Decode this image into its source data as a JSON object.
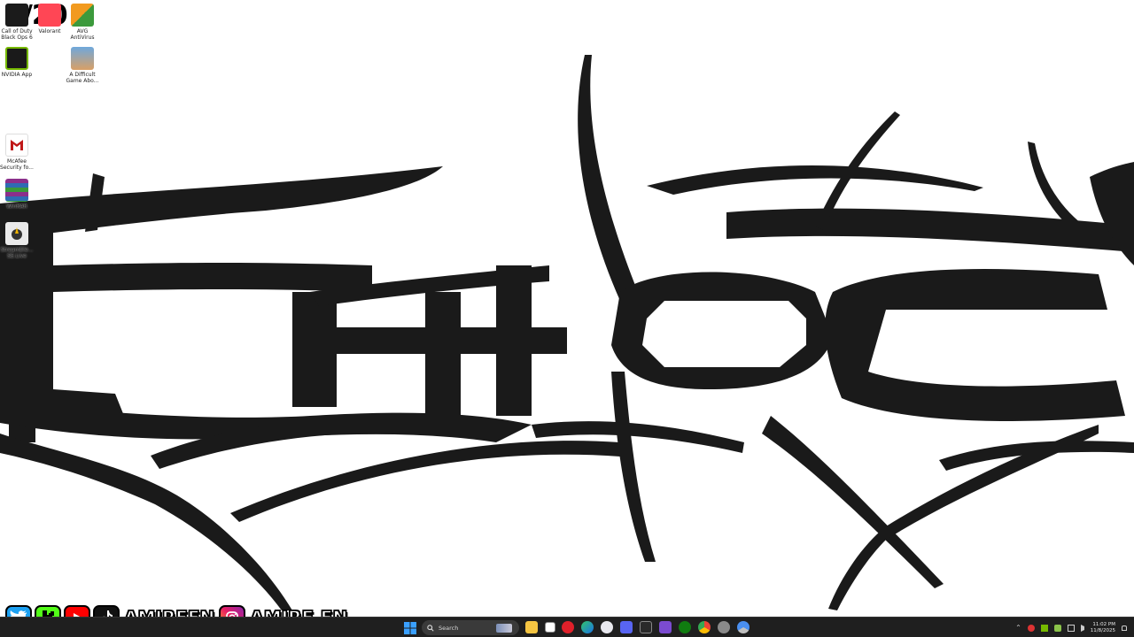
{
  "overlay": {
    "counter": "0/20"
  },
  "desktop": {
    "icons": [
      {
        "label": "Call of Duty\nBlack Ops 6",
        "icon": "cod-icon",
        "color": "#1b1b1b"
      },
      {
        "label": "Valorant",
        "icon": "valorant-icon",
        "color": "#ff4655"
      },
      {
        "label": "AVG\nAntiVirus",
        "icon": "avg-icon",
        "color": "#f29a1f"
      },
      {
        "label": "NVIDIA App",
        "icon": "nvidia-icon",
        "color": "#76b900"
      },
      {
        "label": "A Difficult\nGame Abo...",
        "icon": "game-icon",
        "color": "#6fa8dc"
      },
      {
        "label": "McAfee\nSecurity fo...",
        "icon": "mcafee-icon",
        "color": "#c01818"
      },
      {
        "label": "WinRAR",
        "icon": "winrar-icon",
        "color": "#8b2f8b"
      },
      {
        "label": "StreamEle...\nSE.Live",
        "icon": "streamelements-icon",
        "color": "#333333"
      }
    ]
  },
  "social": {
    "handles": [
      "AMIREFN",
      "AMIRE.FN"
    ],
    "icons": [
      "twitter-icon",
      "kick-icon",
      "youtube-icon",
      "tiktok-icon",
      "instagram-icon"
    ]
  },
  "taskbar": {
    "search_placeholder": "Search",
    "apps": [
      "file-explorer-icon",
      "task-view-icon",
      "opera-icon",
      "edge-icon",
      "itunes-icon",
      "discord-icon",
      "epic-games-icon",
      "app-icon",
      "xbox-icon",
      "chrome-icon",
      "settings-icon",
      "chrome-dev-icon"
    ],
    "clock": {
      "time": "11:02 PM",
      "date": "11/8/2025"
    }
  },
  "colors": {
    "taskbar_bg": "#1f1f1f",
    "wallpaper_ink": "#1a1a1a",
    "wallpaper_bg": "#ffffff"
  }
}
